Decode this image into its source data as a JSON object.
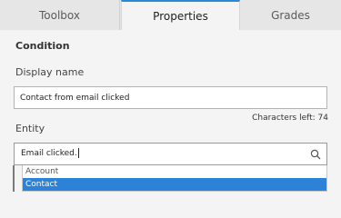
{
  "tabs": [
    {
      "label": "Toolbox"
    },
    {
      "label": "Properties",
      "active": true
    },
    {
      "label": "Grades"
    }
  ],
  "section_title": "Condition",
  "display_name": {
    "label": "Display name",
    "value": "Contact from email clicked",
    "characters_left": "Characters left: 74"
  },
  "entity": {
    "label": "Entity",
    "value": "Email clicked.",
    "options": [
      {
        "label": "Account",
        "selected": false
      },
      {
        "label": "Contact",
        "selected": true
      }
    ]
  },
  "colors": {
    "accent": "#2b88d8",
    "selected_option_bg": "#2b82d6"
  },
  "icons": {
    "search": "search-icon"
  }
}
